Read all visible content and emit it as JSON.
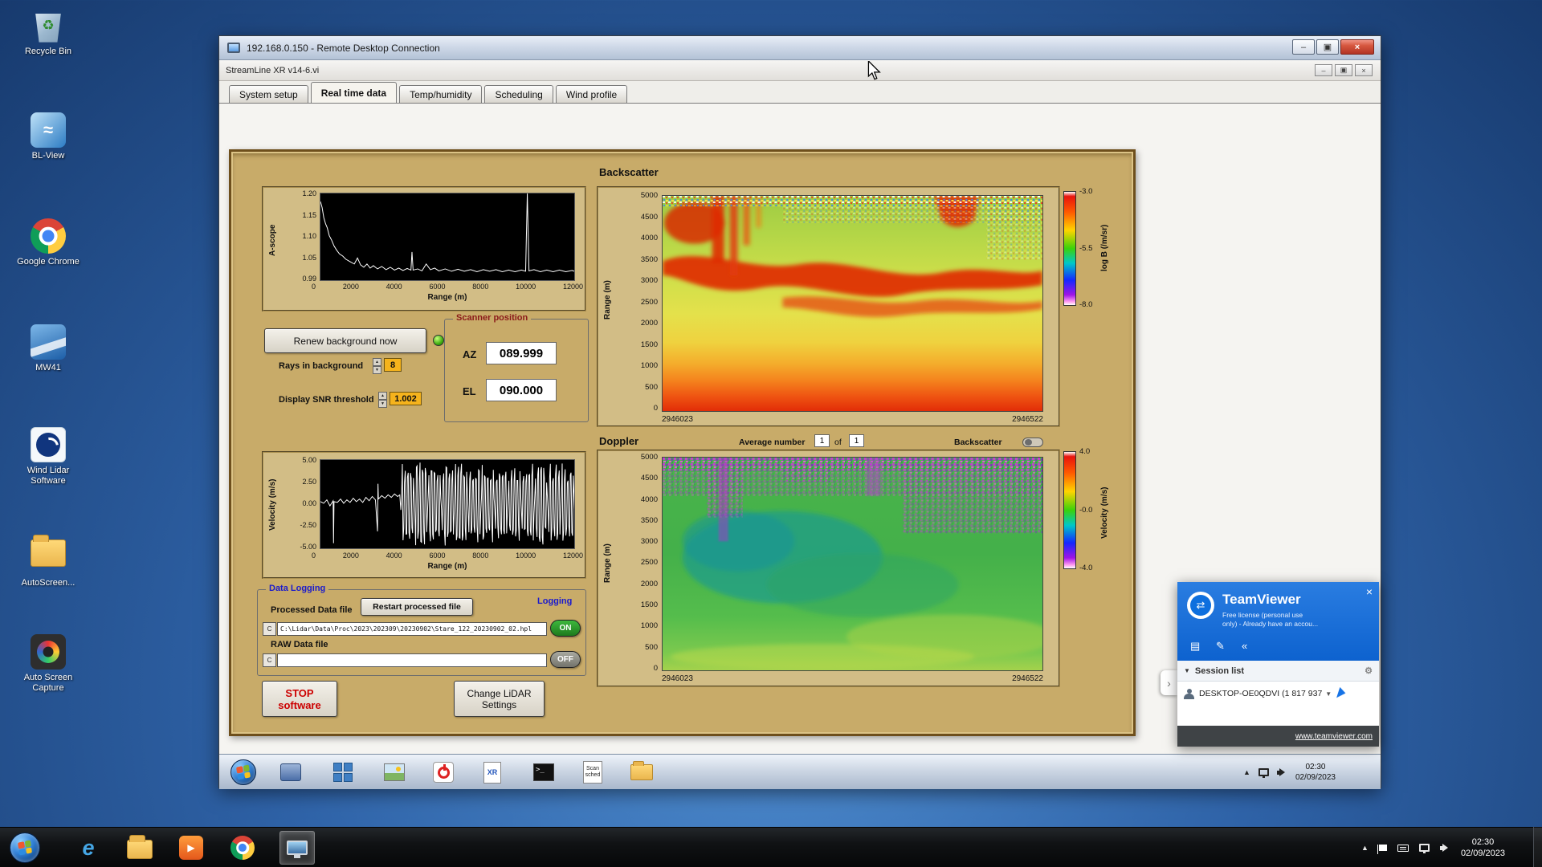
{
  "desktop": {
    "icons": [
      {
        "label": "Recycle Bin",
        "icon": "recycle-bin"
      },
      {
        "label": "BL-View",
        "icon": "bl-view"
      },
      {
        "label": "Google Chrome",
        "icon": "chrome"
      },
      {
        "label": "MW41",
        "icon": "mw41"
      },
      {
        "label": "Wind Lidar Software",
        "icon": "wind-lidar"
      },
      {
        "label": "AutoScreen...",
        "icon": "folder"
      },
      {
        "label": "Auto Screen Capture",
        "icon": "camera-lens"
      }
    ]
  },
  "rdp": {
    "title": "192.168.0.150 - Remote Desktop Connection"
  },
  "app": {
    "title": "StreamLine XR v14-6.vi",
    "tabs": [
      {
        "label": "System setup"
      },
      {
        "label": "Real time data"
      },
      {
        "label": "Temp/humidity"
      },
      {
        "label": "Scheduling"
      },
      {
        "label": "Wind profile"
      }
    ]
  },
  "panel": {
    "ascope": {
      "ylabel": "A-scope",
      "xlabel": "Range (m)",
      "yticks": [
        "1.20",
        "1.15",
        "1.10",
        "1.05",
        "0.99"
      ],
      "xticks": [
        "0",
        "2000",
        "4000",
        "6000",
        "8000",
        "10000",
        "12000"
      ],
      "trace": [
        [
          0,
          1.185
        ],
        [
          80,
          1.17
        ],
        [
          160,
          1.145
        ],
        [
          240,
          1.13
        ],
        [
          320,
          1.12
        ],
        [
          420,
          1.1
        ],
        [
          520,
          1.09
        ],
        [
          640,
          1.075
        ],
        [
          760,
          1.065
        ],
        [
          900,
          1.055
        ],
        [
          1050,
          1.05
        ],
        [
          1200,
          1.042
        ],
        [
          1400,
          1.036
        ],
        [
          1600,
          1.03
        ],
        [
          1750,
          1.045
        ],
        [
          1900,
          1.028
        ],
        [
          2050,
          1.022
        ],
        [
          2200,
          1.03
        ],
        [
          2350,
          1.02
        ],
        [
          2500,
          1.026
        ],
        [
          2700,
          1.018
        ],
        [
          2900,
          1.024
        ],
        [
          3100,
          1.016
        ],
        [
          3300,
          1.022
        ],
        [
          3500,
          1.015
        ],
        [
          3700,
          1.02
        ],
        [
          3900,
          1.014
        ],
        [
          4100,
          1.019
        ],
        [
          4280,
          1.015
        ],
        [
          4330,
          1.06
        ],
        [
          4380,
          1.015
        ],
        [
          4600,
          1.018
        ],
        [
          4800,
          1.013
        ],
        [
          5000,
          1.03
        ],
        [
          5200,
          1.016
        ],
        [
          5400,
          1.02
        ],
        [
          5600,
          1.013
        ],
        [
          5900,
          1.018
        ],
        [
          6200,
          1.012
        ],
        [
          6500,
          1.017
        ],
        [
          6800,
          1.012
        ],
        [
          7100,
          1.016
        ],
        [
          7400,
          1.011
        ],
        [
          7700,
          1.016
        ],
        [
          8000,
          1.012
        ],
        [
          8300,
          1.016
        ],
        [
          8600,
          1.011
        ],
        [
          8900,
          1.015
        ],
        [
          9200,
          1.011
        ],
        [
          9500,
          1.015
        ],
        [
          9700,
          1.012
        ],
        [
          9780,
          1.205
        ],
        [
          9860,
          1.013
        ],
        [
          10100,
          1.016
        ],
        [
          10400,
          1.011
        ],
        [
          10700,
          1.015
        ],
        [
          11000,
          1.011
        ],
        [
          11300,
          1.015
        ],
        [
          11600,
          1.011
        ],
        [
          11900,
          1.014
        ],
        [
          12000,
          1.012
        ]
      ]
    },
    "background_controls": {
      "renew": "Renew background now",
      "rays_label": "Rays in background",
      "rays_value": "8",
      "snr_label": "Display SNR threshold",
      "snr_value": "1.002"
    },
    "scanner": {
      "title": "Scanner position",
      "az_label": "AZ",
      "az_value": "089.999",
      "el_label": "EL",
      "el_value": "090.000"
    },
    "backscatter": {
      "title": "Backscatter",
      "ylabel": "Range (m)",
      "yticks": [
        "5000",
        "4500",
        "4000",
        "3500",
        "3000",
        "2500",
        "2000",
        "1500",
        "1000",
        "500",
        "0"
      ],
      "x_left": "2946023",
      "x_right": "2946522",
      "cb_ticks": [
        "-3.0",
        "-5.5",
        "-8.0"
      ],
      "cb_label": "log B (/m/sr)"
    },
    "doppler": {
      "title": "Doppler",
      "avg_label": "Average number",
      "avg_value": "1",
      "of_label": "of",
      "of_count": "1",
      "toggle_label": "Backscatter",
      "ylabel": "Range (m)",
      "yticks": [
        "5000",
        "4500",
        "4000",
        "3500",
        "3000",
        "2500",
        "2000",
        "1500",
        "1000",
        "500",
        "0"
      ],
      "x_left": "2946023",
      "x_right": "2946522",
      "cb_ticks": [
        "4.0",
        "-0.0",
        "-4.0"
      ],
      "cb_label": "Velocity (m/s)"
    },
    "velocity": {
      "ylabel": "Velocity (m/s)",
      "xlabel": "Range (m)",
      "yticks": [
        "5.00",
        "2.50",
        "0.00",
        "-2.50",
        "-5.00"
      ],
      "xticks": [
        "0",
        "2000",
        "4000",
        "6000",
        "8000",
        "10000",
        "12000"
      ],
      "trace_head": [
        [
          0,
          0.3
        ],
        [
          150,
          0.1
        ],
        [
          300,
          0.5
        ],
        [
          450,
          -0.2
        ],
        [
          600,
          0.4
        ],
        [
          620,
          -4.6
        ],
        [
          640,
          0.3
        ],
        [
          800,
          0.2
        ],
        [
          950,
          0.6
        ],
        [
          1100,
          0.1
        ],
        [
          1250,
          0.5
        ],
        [
          1400,
          0.2
        ],
        [
          1550,
          0.7
        ],
        [
          1700,
          0.3
        ],
        [
          1850,
          0.6
        ],
        [
          2000,
          0.2
        ],
        [
          2150,
          0.8
        ],
        [
          2300,
          0.4
        ],
        [
          2450,
          0.9
        ],
        [
          2600,
          0.5
        ],
        [
          2700,
          -3.2
        ],
        [
          2720,
          2.4
        ],
        [
          2740,
          0.6
        ],
        [
          2900,
          1.0
        ],
        [
          3050,
          0.7
        ],
        [
          3200,
          1.1
        ],
        [
          3350,
          0.8
        ],
        [
          3500,
          1.2
        ],
        [
          3650,
          0.9
        ],
        [
          3750,
          1.1
        ]
      ],
      "noise": {
        "from": 3800,
        "to": 12000,
        "step": 70,
        "amp": 4.9
      }
    },
    "logging": {
      "title": "Data Logging",
      "right_label": "Logging",
      "processed_label": "Processed Data file",
      "restart": "Restart processed file",
      "drive": "C",
      "processed_path": "C:\\Lidar\\Data\\Proc\\2023\\202309\\20230902\\Stare_122_20230902_02.hpl",
      "on": "ON",
      "raw_label": "RAW Data file",
      "raw_path": "",
      "off": "OFF"
    },
    "stop1": "STOP",
    "stop2": "software",
    "chg1": "Change LiDAR",
    "chg2": "Settings"
  },
  "remote_taskbar": {
    "time": "02:30",
    "date": "02/09/2023",
    "scan1": "Scan",
    "scan2": "sched",
    "xr": "XR",
    "icons": [
      "start",
      "app-window",
      "display-grid",
      "photo-viewer",
      "power-off",
      "xr-document",
      "command-prompt",
      "scan-scheduler",
      "folder"
    ]
  },
  "teamviewer": {
    "brand": "TeamViewer",
    "license1": "Free license (personal use",
    "license2": "only) - Already have an accou...",
    "session_list": "Session list",
    "entry": "DESKTOP-OE0QDVI (1 817 937",
    "link": "www.teamviewer.com"
  },
  "host_taskbar": {
    "time": "02:30",
    "date": "02/09/2023",
    "icons": [
      "start",
      "internet-explorer",
      "file-explorer",
      "media-player",
      "chrome",
      "remote-desktop-active"
    ]
  }
}
